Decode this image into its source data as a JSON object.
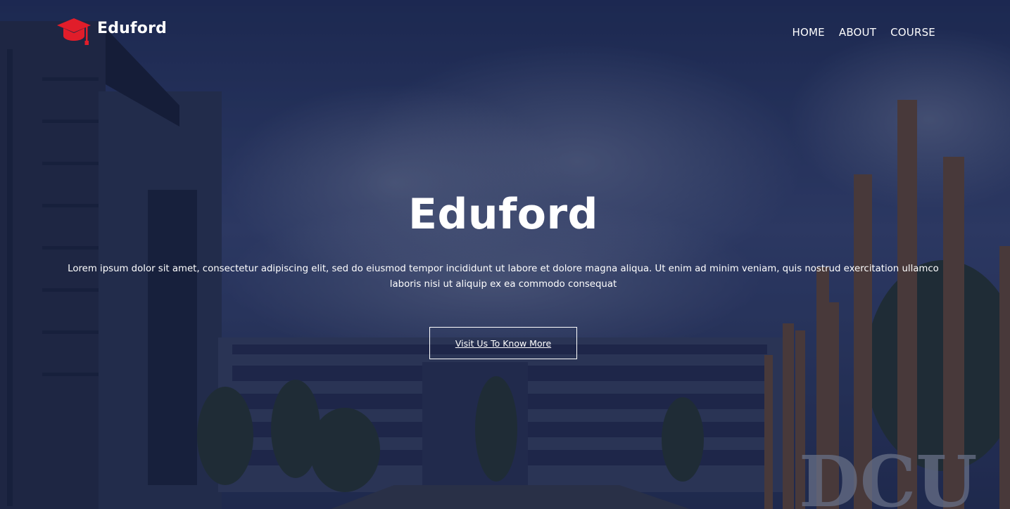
{
  "brand": {
    "name": "Eduford",
    "icon": "graduation-cap-icon",
    "icon_color": "#e11d2a"
  },
  "nav": {
    "items": [
      {
        "label": "HOME"
      },
      {
        "label": "ABOUT"
      },
      {
        "label": "COURSE"
      }
    ]
  },
  "hero": {
    "title": "Eduford",
    "description": "Lorem ipsum dolor sit amet, consectetur adipiscing elit, sed do eiusmod tempor incididunt ut labore et dolore magna aliqua. Ut enim ad minim veniam, quis nostrud exercitation ullamco laboris nisi ut aliquip ex ea commodo consequat",
    "cta_label": "Visit Us To Know More",
    "background_sign_text": "DCU"
  },
  "colors": {
    "overlay": "#0a143c",
    "text": "#ffffff",
    "accent": "#e11d2a"
  }
}
